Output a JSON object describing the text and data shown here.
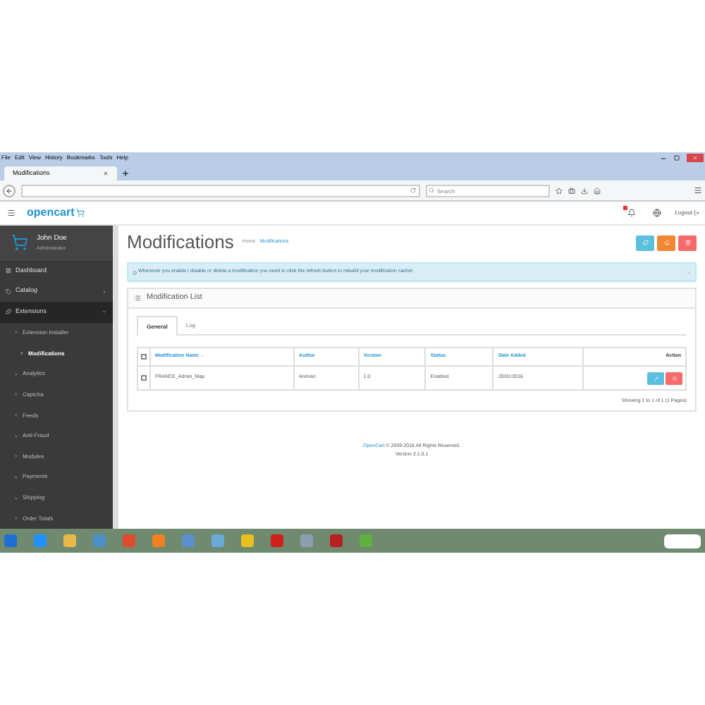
{
  "browser": {
    "menu": [
      "File",
      "Edit",
      "View",
      "History",
      "Bookmarks",
      "Tools",
      "Help"
    ],
    "tab": {
      "title": "Modifications"
    },
    "search": {
      "placeholder": "Search"
    }
  },
  "header": {
    "logo": "opencart",
    "logout": "Logout"
  },
  "user": {
    "name": "John Doe",
    "role": "Administrator"
  },
  "sidebar": {
    "items": [
      {
        "label": "Dashboard",
        "expanded": false
      },
      {
        "label": "Catalog",
        "expanded": false
      },
      {
        "label": "Extensions",
        "expanded": true,
        "children": [
          {
            "label": "Extension Installer",
            "selected": false
          },
          {
            "label": "Modifications",
            "selected": true
          },
          {
            "label": "Analytics",
            "selected": false
          },
          {
            "label": "Captcha",
            "selected": false
          },
          {
            "label": "Feeds",
            "selected": false
          },
          {
            "label": "Anti-Fraud",
            "selected": false
          },
          {
            "label": "Modules",
            "selected": false
          },
          {
            "label": "Payments",
            "selected": false
          },
          {
            "label": "Shipping",
            "selected": false
          },
          {
            "label": "Order Totals",
            "selected": false
          }
        ]
      }
    ]
  },
  "page": {
    "title": "Modifications",
    "breadcrumb": [
      "Home",
      "Modifications"
    ]
  },
  "alert": "Whenever you enable / disable or delete a modification you need to click the refresh button to rebuild your modification cache!",
  "panel": {
    "title": "Modification List",
    "tabs": [
      {
        "label": "General",
        "selected": true
      },
      {
        "label": "Log",
        "selected": false
      }
    ]
  },
  "table": {
    "select_all_checked": false,
    "columns": [
      "Modification Name",
      "Author",
      "Version",
      "Status",
      "Date Added",
      "Action"
    ],
    "rows": [
      {
        "checked": false,
        "cells": [
          "FRANCE_Admin_Map",
          "Anirvan",
          "1.0",
          "Enabled",
          "20/01/2016"
        ]
      }
    ],
    "pagination": "Showing 1 to 1 of 1 (1 Pages)"
  },
  "footer": {
    "link": "OpenCart",
    "text": "© 2009-2016 All Rights Reserved.",
    "version": "Version 2.1.0.1"
  }
}
